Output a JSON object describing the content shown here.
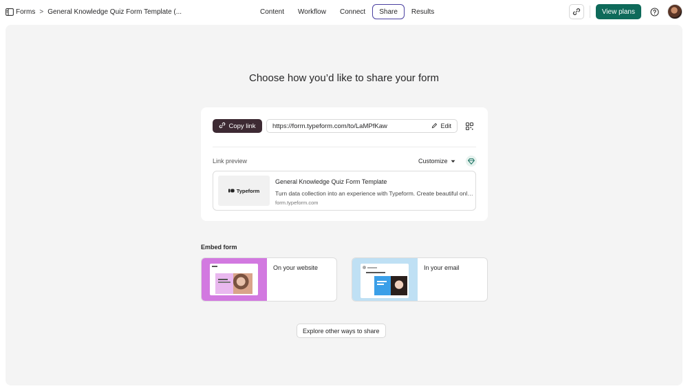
{
  "header": {
    "breadcrumb_root": "Forms",
    "breadcrumb_separator": ">",
    "form_title": "General Knowledge Quiz Form Template (...",
    "tabs": [
      {
        "label": "Content",
        "active": false
      },
      {
        "label": "Workflow",
        "active": false
      },
      {
        "label": "Connect",
        "active": false
      },
      {
        "label": "Share",
        "active": true
      },
      {
        "label": "Results",
        "active": false
      }
    ],
    "view_plans_label": "View plans",
    "accent_color": "#0e6a5a"
  },
  "main": {
    "heading": "Choose how you’d like to share your form",
    "copy_link_label": "Copy link",
    "url": "https://form.typeform.com/to/LaMPfKaw",
    "edit_label": "Edit",
    "link_preview_label": "Link preview",
    "customize_label": "Customize",
    "preview": {
      "brand": "Typeform",
      "title": "General Knowledge Quiz Form Template",
      "description": "Turn data collection into an experience with Typeform. Create beautiful online forms",
      "domain": "form.typeform.com"
    },
    "embed_title": "Embed form",
    "embed_options": [
      {
        "label": "On your website",
        "color": "#d279e0"
      },
      {
        "label": "In your email",
        "color": "#bfe0f4"
      }
    ],
    "explore_label": "Explore other ways to share"
  }
}
